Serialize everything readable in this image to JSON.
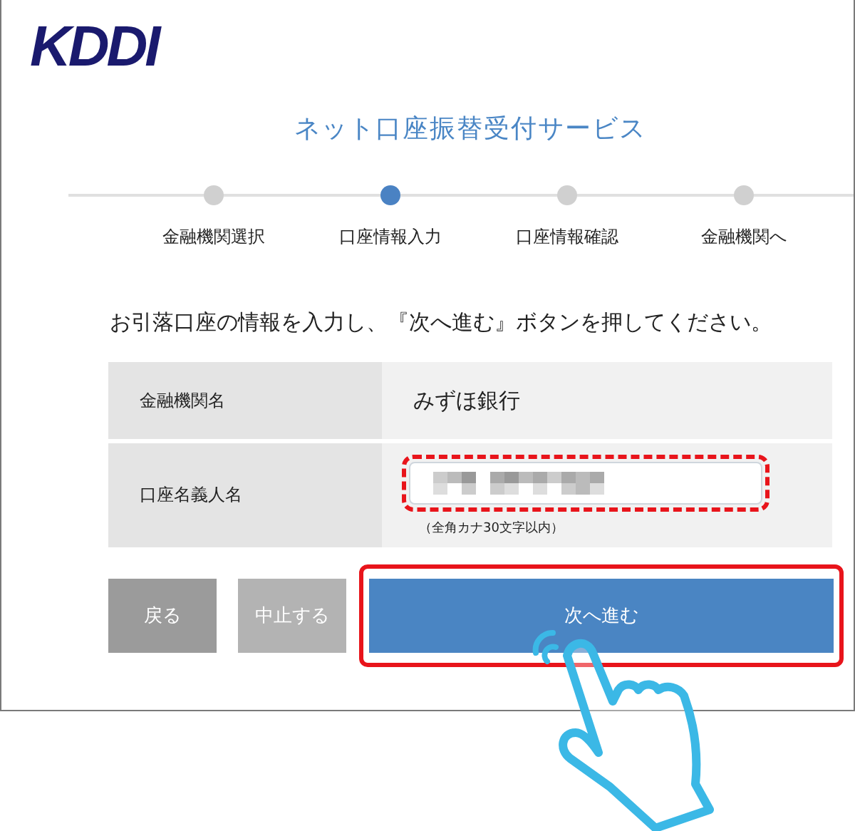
{
  "logo": "KDDI",
  "title": "ネット口座振替受付サービス",
  "steps": [
    {
      "label": "金融機関選択",
      "selected": false
    },
    {
      "label": "口座情報入力",
      "selected": true
    },
    {
      "label": "口座情報確認",
      "selected": false
    },
    {
      "label": "金融機関へ",
      "selected": false
    }
  ],
  "instruction": "お引落口座の情報を入力し、『次へ進む』ボタンを押してください。",
  "form": [
    {
      "kind": "text",
      "label": "金融機関名",
      "value": "みずほ銀行"
    },
    {
      "kind": "input",
      "label": "口座名義人名",
      "hint": "（全角カナ30文字以内）"
    }
  ],
  "buttons": [
    {
      "kind": "back",
      "label": "戻る"
    },
    {
      "kind": "cancel",
      "label": "中止する"
    },
    {
      "kind": "primary",
      "label": "次へ進む"
    }
  ]
}
